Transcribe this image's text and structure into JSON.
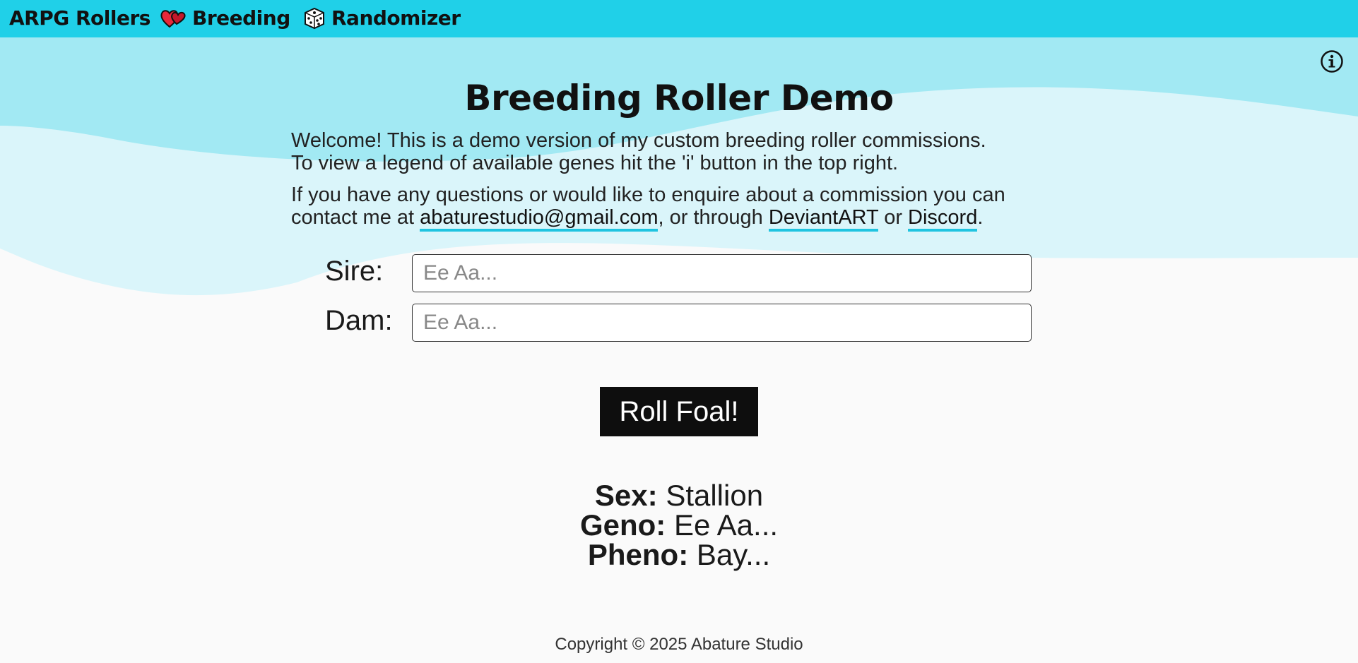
{
  "nav": {
    "brand": "ARPG Rollers",
    "items": [
      {
        "label": "Breeding",
        "icon": "hearts-icon"
      },
      {
        "label": "Randomizer",
        "icon": "dice-icon"
      }
    ]
  },
  "info_button": {
    "icon": "info-icon"
  },
  "main": {
    "title": "Breeding Roller Demo",
    "intro_line1": "Welcome! This is a demo version of my custom breeding roller commissions.",
    "intro_line2": "To view a legend of available genes hit the 'i' button in the top right.",
    "contact_prefix": "If you have any questions or would like to enquire about a commission you can contact me at ",
    "email": "abaturestudio@gmail.com",
    "contact_mid": ", or through ",
    "deviantart": "DeviantART",
    "contact_or": " or ",
    "discord": "Discord",
    "contact_suffix": "."
  },
  "form": {
    "sire_label": "Sire:",
    "sire_value": "",
    "sire_placeholder": "Ee Aa...",
    "dam_label": "Dam:",
    "dam_value": "",
    "dam_placeholder": "Ee Aa...",
    "roll_button": "Roll Foal!"
  },
  "result": {
    "sex_label": "Sex:",
    "sex_value": "Stallion",
    "geno_label": "Geno:",
    "geno_value": "Ee Aa...",
    "pheno_label": "Pheno:",
    "pheno_value": "Bay..."
  },
  "footer": {
    "copyright": "Copyright © 2025 Abature Studio"
  },
  "colors": {
    "nav_bg": "#20d0e8",
    "wave_top": "#a2e9f3",
    "wave_light": "#daf5fa",
    "link_underline": "#20c4e0",
    "button_bg": "#0e0e0e",
    "page_bg": "#fafafa"
  }
}
